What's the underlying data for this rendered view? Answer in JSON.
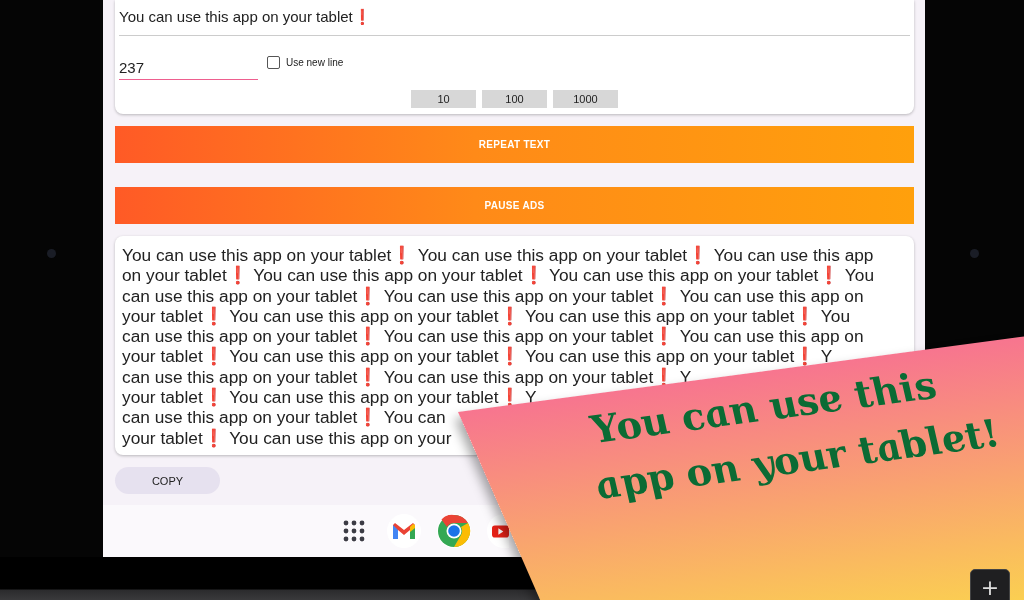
{
  "input_text": {
    "value": "You can use this app on your tablet❗"
  },
  "count_field": {
    "value": "237"
  },
  "new_line_checkbox": {
    "label": "Use new line",
    "checked": false
  },
  "presets": [
    "10",
    "100",
    "1000"
  ],
  "repeat_button": "REPEAT TEXT",
  "pause_ads_button": "PAUSE ADS",
  "output_lines": [
    "You can use this app on your tablet❗ You can use this app on your tablet❗ You can use this app",
    "on your tablet❗ You can use this app on your tablet❗ You can use this app on your tablet❗ You",
    "can use this app on your tablet❗ You can use this app on your tablet❗ You can use this app on",
    "your tablet❗ You can use this app on your tablet❗ You can use this app on your tablet❗ You",
    "can use this app on your tablet❗ You can use this app on your tablet❗ You can use this app on",
    "your tablet❗ You can use this app on your tablet❗ You can use this app on your tablet❗ Y",
    "can use this app on your tablet❗ You can use this app on your tablet❗ Y",
    "your tablet❗ You can use this app on your tablet❗ Y",
    "can use this app on your tablet❗ You can",
    "your tablet❗ You can use this app on your"
  ],
  "copy_button": "COPY",
  "dock": [
    {
      "kind": "apps"
    },
    {
      "kind": "mail"
    },
    {
      "kind": "browser"
    },
    {
      "kind": "video"
    }
  ],
  "corner_button": "+",
  "banner": {
    "lines": [
      "You can use this",
      "app on your tablet!"
    ]
  }
}
